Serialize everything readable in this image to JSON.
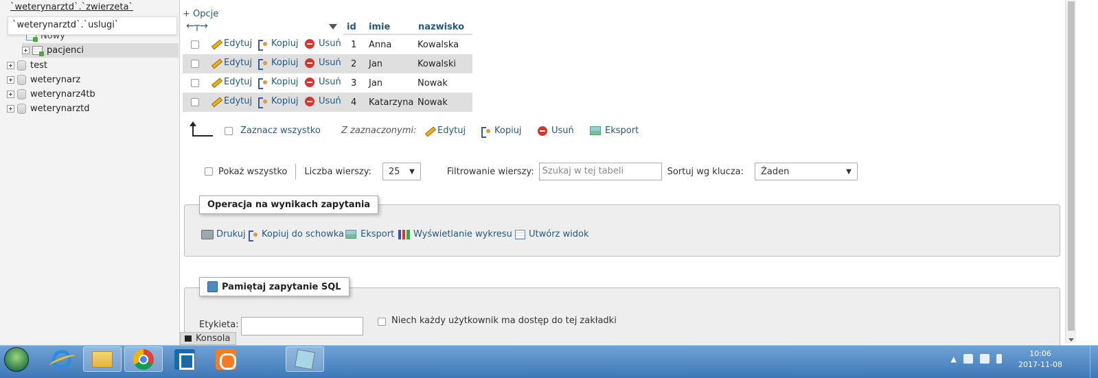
{
  "nav": {
    "breadcrumb": "`weterynarztd`.`zwierzeta`",
    "tooltip": "`weterynarztd`.`uslugi`",
    "partial_item": "Nowy",
    "table_item": "pacjenci",
    "databases": [
      "test",
      "weterynarz",
      "weterynarz4tb",
      "weterynarztd"
    ]
  },
  "results": {
    "options_link": "+ Opcje",
    "col_arrows": "←┬→",
    "headers": [
      "id",
      "imie",
      "nazwisko"
    ],
    "actions": {
      "edit": "Edytuj",
      "copy": "Kopiuj",
      "delete": "Usuń"
    },
    "rows": [
      {
        "id": "1",
        "imie": "Anna",
        "nazwisko": "Kowalska"
      },
      {
        "id": "2",
        "imie": "Jan",
        "nazwisko": "Kowalski"
      },
      {
        "id": "3",
        "imie": "Jan",
        "nazwisko": "Nowak"
      },
      {
        "id": "4",
        "imie": "Katarzyna",
        "nazwisko": "Nowak"
      }
    ]
  },
  "bulk": {
    "select_all": "Zaznacz wszystko",
    "with_selected": "Z zaznaczonymi:",
    "edit": "Edytuj",
    "copy": "Kopiuj",
    "delete": "Usuń",
    "export": "Eksport"
  },
  "controls": {
    "show_all": "Pokaż wszystko",
    "rows_label": "Liczba wierszy:",
    "rows_value": "25",
    "filter_label": "Filtrowanie wierszy:",
    "filter_placeholder": "Szukaj w tej tabeli",
    "sort_label": "Sortuj wg klucza:",
    "sort_value": "Żaden"
  },
  "query_ops": {
    "legend": "Operacja na wynikach zapytania",
    "print": "Drukuj",
    "copy_clipboard": "Kopiuj do schowka",
    "export": "Eksport",
    "chart": "Wyświetlanie wykresu",
    "create_view": "Utwórz widok"
  },
  "bookmark": {
    "legend": "Pamiętaj zapytanie SQL",
    "label": "Etykieta:",
    "shared": "Niech każdy użytkownik ma dostęp do tej zakładki"
  },
  "console": "Konsola",
  "taskbar": {
    "time": "10:06",
    "date": "2017-11-08"
  }
}
